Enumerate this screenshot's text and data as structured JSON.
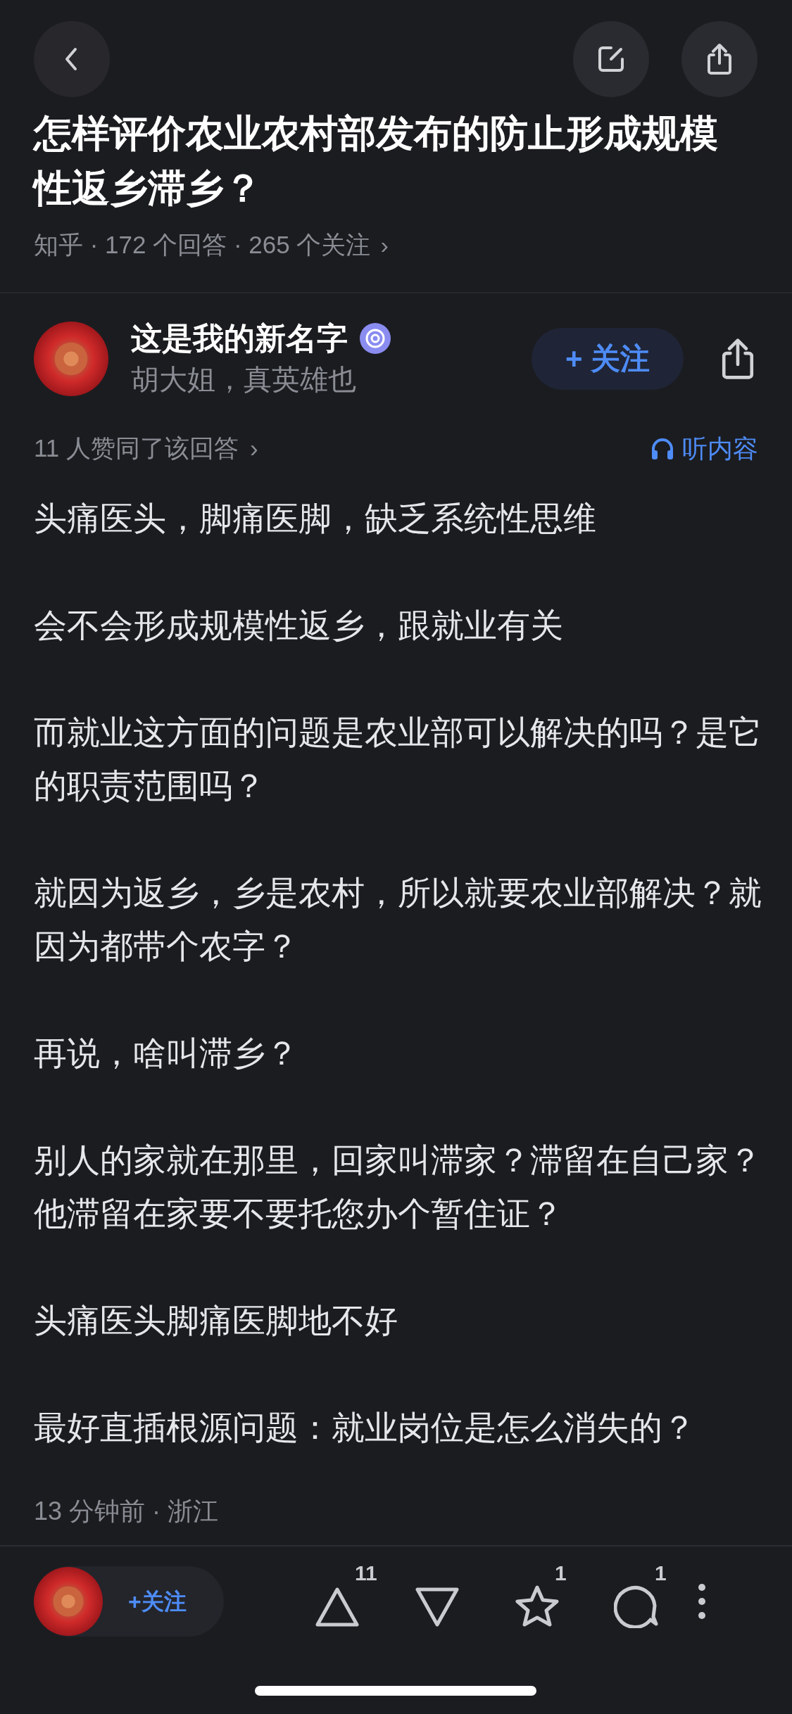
{
  "question": {
    "title": "怎样评价农业农村部发布的防止形成规模性返乡滞乡？",
    "meta": "知乎 · 172 个回答 · 265 个关注",
    "meta_arrow": "›"
  },
  "author": {
    "name": "这是我的新名字",
    "bio": "胡大姐，真英雄也",
    "follow_label": "关注",
    "follow_sign": "+"
  },
  "answer": {
    "approvals": "11 人赞同了该回答",
    "approvals_arrow": "›",
    "listen": "听内容",
    "paragraphs": [
      "头痛医头，脚痛医脚，缺乏系统性思维",
      "会不会形成规模性返乡，跟就业有关",
      "而就业这方面的问题是农业部可以解决的吗？是它的职责范围吗？",
      "就因为返乡，乡是农村，所以就要农业部解决？就因为都带个农字？",
      "再说，啥叫滞乡？",
      "别人的家就在那里，回家叫滞家？滞留在自己家？他滞留在家要不要托您办个暂住证？",
      "头痛医头脚痛医脚地不好",
      "最好直插根源问题：就业岗位是怎么消失的？"
    ],
    "footer": "13 分钟前 · 浙江"
  },
  "bottom_bar": {
    "follow_label": "关注",
    "follow_sign": "+",
    "upvotes": "11",
    "favorites": "1",
    "comments": "1"
  }
}
